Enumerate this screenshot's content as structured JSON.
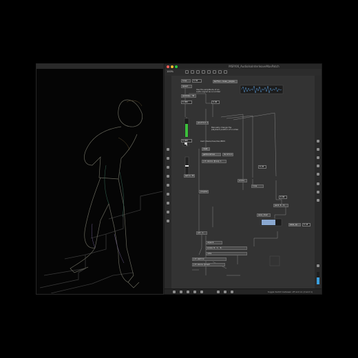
{
  "video_window": {
    "title": ""
  },
  "max_window": {
    "title": "MSP/06_AudioIsoInterleaveMaxPatch",
    "toolbar": {
      "zoom": "100%"
    },
    "status": "toggle Switch between off and on (0 and 1)"
  },
  "patch": {
    "comments": {
      "amp": "Use the amplitude of an audio signal as a number",
      "jitter": "Manually change the playback position of a video",
      "load": "load /Users/max/dev/MOV",
      "ease": "ease_down",
      "scale_cmt": "scale"
    },
    "objects": {
      "buffer": "buffer~ buse_jongle",
      "loop": "loop",
      "snapshot": "snapshot~ 30",
      "peakamp": "peakamp~ 30",
      "number1": "0.000",
      "number2": "0.000",
      "position": "position 10",
      "read": "read",
      "jit_movie": "jit.movie @loop 1",
      "jit_movie2": "jit.movie @read",
      "playback": "playback",
      "getduration": "getduration",
      "duration": "duration",
      "vol": "vol 1.",
      "num_a": "0.50",
      "num_b": "0.25",
      "num_c": "0.00",
      "num_d": "0.00",
      "scale_obj": "scale 0. 1. 0.",
      "line": "line",
      "ease_down": "ease_down",
      "ease_up": "ease_up",
      "val": "0.18",
      "jit_window": "jit.window",
      "jit_gl": "jit.gl.videoplane",
      "p": "p position",
      "metro": "metro 33",
      "toggle": "toggle",
      "dac": "ezdac~",
      "pack": "pack 0. 0.",
      "unpack": "unpack",
      "speed": "speed",
      "rate": "rate",
      "jit_matrix": "jit.matrix",
      "jit_pwindow": "jit.pwindow",
      "bang": "bang"
    }
  }
}
